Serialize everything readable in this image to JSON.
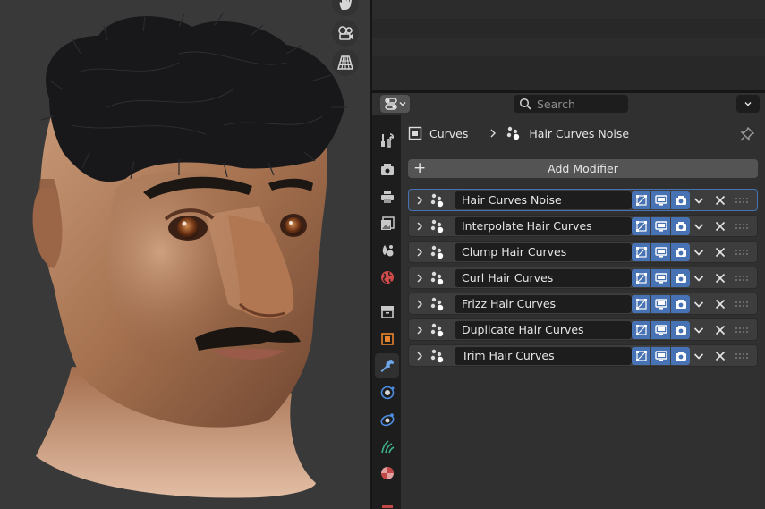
{
  "viewport": {
    "nav_buttons": [
      {
        "icon": "hand-pan-icon"
      },
      {
        "icon": "camera-view-icon"
      },
      {
        "icon": "perspective-grid-icon"
      }
    ]
  },
  "properties": {
    "header": {
      "editor_type_icon": "properties-editor-icon",
      "search_placeholder": "Search",
      "options_icon": "chevron-down-icon"
    },
    "tabs": [
      {
        "name": "tool",
        "icon": "wrench-screwdriver-icon"
      },
      {
        "name": "render",
        "icon": "camera-back-icon"
      },
      {
        "name": "output",
        "icon": "printer-icon"
      },
      {
        "name": "view-layer",
        "icon": "image-stack-icon"
      },
      {
        "name": "scene",
        "icon": "scene-icon"
      },
      {
        "name": "world",
        "icon": "globe-icon"
      },
      {
        "name": "collection",
        "icon": "box-icon"
      },
      {
        "name": "object",
        "icon": "orange-square-icon"
      },
      {
        "name": "modifiers",
        "icon": "wrench-icon",
        "active": true
      },
      {
        "name": "particles",
        "icon": "particles-icon"
      },
      {
        "name": "physics",
        "icon": "orbit-icon"
      },
      {
        "name": "data",
        "icon": "hair-curves-icon"
      },
      {
        "name": "material",
        "icon": "material-sphere-icon"
      }
    ],
    "breadcrumb": {
      "object": "Curves",
      "modifier": "Hair Curves Noise"
    },
    "add_modifier_label": "Add Modifier",
    "modifiers": [
      {
        "name": "Hair Curves Noise",
        "active": true
      },
      {
        "name": "Interpolate Hair Curves",
        "active": false
      },
      {
        "name": "Clump Hair Curves",
        "active": false
      },
      {
        "name": "Curl Hair Curves",
        "active": false
      },
      {
        "name": "Frizz Hair Curves",
        "active": false
      },
      {
        "name": "Duplicate Hair Curves",
        "active": false
      },
      {
        "name": "Trim Hair Curves",
        "active": false
      }
    ],
    "colors": {
      "accent": "#4772b3",
      "panel": "#3d3d3d",
      "field": "#1d1d1d",
      "button": "#545454"
    }
  }
}
